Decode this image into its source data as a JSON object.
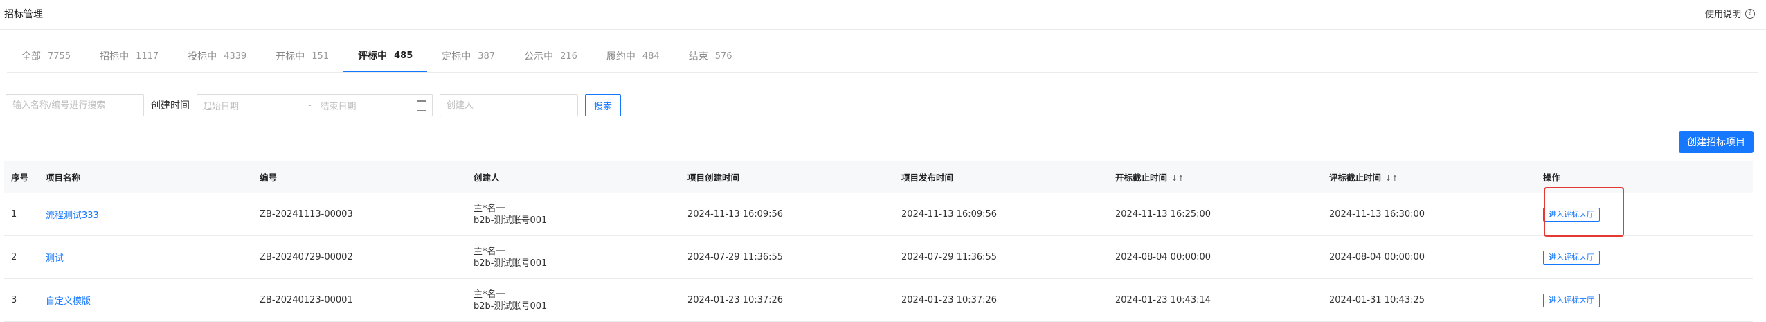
{
  "header": {
    "title": "招标管理",
    "help_label": "使用说明",
    "help_icon": "question-circle-icon"
  },
  "tabs": [
    {
      "label": "全部",
      "count": "7755",
      "active": false
    },
    {
      "label": "招标中",
      "count": "1117",
      "active": false
    },
    {
      "label": "投标中",
      "count": "4339",
      "active": false
    },
    {
      "label": "开标中",
      "count": "151",
      "active": false
    },
    {
      "label": "评标中",
      "count": "485",
      "active": true
    },
    {
      "label": "定标中",
      "count": "387",
      "active": false
    },
    {
      "label": "公示中",
      "count": "216",
      "active": false
    },
    {
      "label": "履约中",
      "count": "484",
      "active": false
    },
    {
      "label": "结束",
      "count": "576",
      "active": false
    }
  ],
  "filters": {
    "keyword_placeholder": "输入名称/编号进行搜索",
    "date_label": "创建时间",
    "start_placeholder": "起始日期",
    "date_separator": "-",
    "end_placeholder": "结束日期",
    "creator_placeholder": "创建人",
    "search_label": "搜索"
  },
  "create_button": "创建招标项目",
  "table": {
    "headers": {
      "index": "序号",
      "name": "项目名称",
      "code": "编号",
      "creator": "创建人",
      "created": "项目创建时间",
      "published": "项目发布时间",
      "open_deadline": "开标截止时间",
      "eval_deadline": "评标截止时间",
      "actions": "操作"
    },
    "rows": [
      {
        "index": "1",
        "name": "流程测试333",
        "code": "ZB-20241113-00003",
        "creator_name": "主*名一",
        "creator_account": "b2b-测试账号001",
        "created": "2024-11-13 16:09:56",
        "published": "2024-11-13 16:09:56",
        "open_deadline": "2024-11-13 16:25:00",
        "eval_deadline": "2024-11-13 16:30:00",
        "action": "进入评标大厅"
      },
      {
        "index": "2",
        "name": "测试",
        "code": "ZB-20240729-00002",
        "creator_name": "主*名一",
        "creator_account": "b2b-测试账号001",
        "created": "2024-07-29 11:36:55",
        "published": "2024-07-29 11:36:55",
        "open_deadline": "2024-08-04 00:00:00",
        "eval_deadline": "2024-08-04 00:00:00",
        "action": "进入评标大厅"
      },
      {
        "index": "3",
        "name": "自定义模版",
        "code": "ZB-20240123-00001",
        "creator_name": "主*名一",
        "creator_account": "b2b-测试账号001",
        "created": "2024-01-23 10:37:26",
        "published": "2024-01-23 10:37:26",
        "open_deadline": "2024-01-23 10:43:14",
        "eval_deadline": "2024-01-31 10:43:25",
        "action": "进入评标大厅"
      }
    ]
  },
  "colors": {
    "accent": "#1677ff",
    "highlight": "#e53935"
  }
}
